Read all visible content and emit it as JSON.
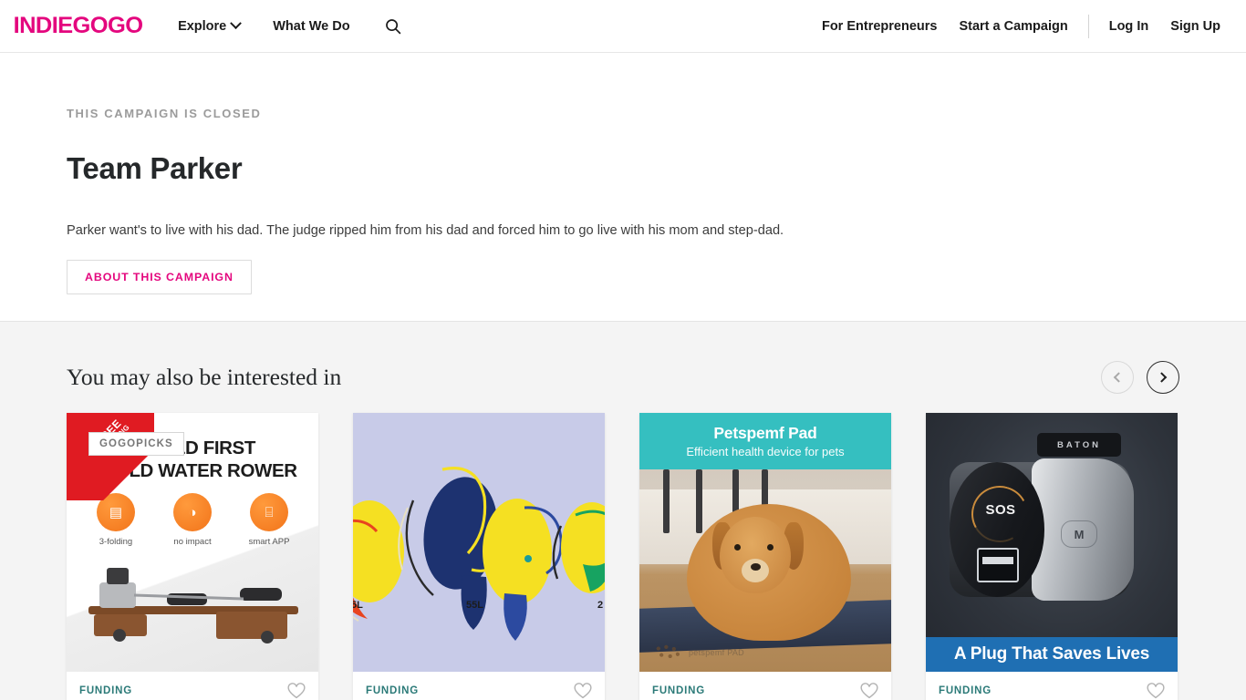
{
  "header": {
    "logo": "INDIEGOGO",
    "nav_left": [
      {
        "label": "Explore",
        "icon": "chevron-down-icon",
        "has_dropdown": true
      },
      {
        "label": "What We Do",
        "has_dropdown": false
      }
    ],
    "search_icon": "search-icon",
    "nav_right": [
      {
        "label": "For Entrepreneurs"
      },
      {
        "label": "Start a Campaign"
      },
      {
        "label": "Log In"
      },
      {
        "label": "Sign Up"
      }
    ]
  },
  "hero": {
    "status": "THIS CAMPAIGN IS CLOSED",
    "title": "Team Parker",
    "tagline": "Parker want's to live with his dad. The judge ripped him from his dad and forced him to go live with his mom and step-dad.",
    "about_button": "ABOUT THIS CAMPAIGN"
  },
  "recommendations": {
    "title": "You may also be interested in",
    "prev_label": "Previous",
    "next_label": "Next",
    "prev_icon": "chevron-left-icon",
    "next_icon": "chevron-right-icon",
    "cards": [
      {
        "status": "FUNDING",
        "favorite_icon": "heart-icon",
        "badge": "GOGOPICKS",
        "ribbon_line1": "FREE",
        "ribbon_line2": "SHIPPING",
        "image_title_line1": "WORLD FIRST",
        "image_title_line2": "3-FOLD WATER ROWER",
        "features": [
          {
            "label": "3-folding",
            "glyph": "▤"
          },
          {
            "label": "no impact",
            "glyph": "◑"
          },
          {
            "label": "smart APP",
            "glyph": "⌸"
          }
        ]
      },
      {
        "status": "FUNDING",
        "favorite_icon": "heart-icon",
        "image_label_center": "55L",
        "image_label_left": "5L",
        "image_label_right": "2"
      },
      {
        "status": "FUNDING",
        "favorite_icon": "heart-icon",
        "banner_title": "Petspemf Pad",
        "banner_subtitle": "Efficient health device for pets",
        "watermark": "petspemf PAD"
      },
      {
        "status": "FUNDING",
        "favorite_icon": "heart-icon",
        "device_brand": "BATON",
        "device_sos": "SOS",
        "device_button": "M",
        "banner": "A Plug That Saves Lives"
      }
    ]
  },
  "colors": {
    "brand_pink": "#e4077e",
    "funding_teal": "#2b7a78",
    "page_bg": "#f4f4f4",
    "ribbon_red": "#e01b22",
    "pet_teal": "#35bfc0",
    "plug_blue": "#1f6fb3"
  }
}
